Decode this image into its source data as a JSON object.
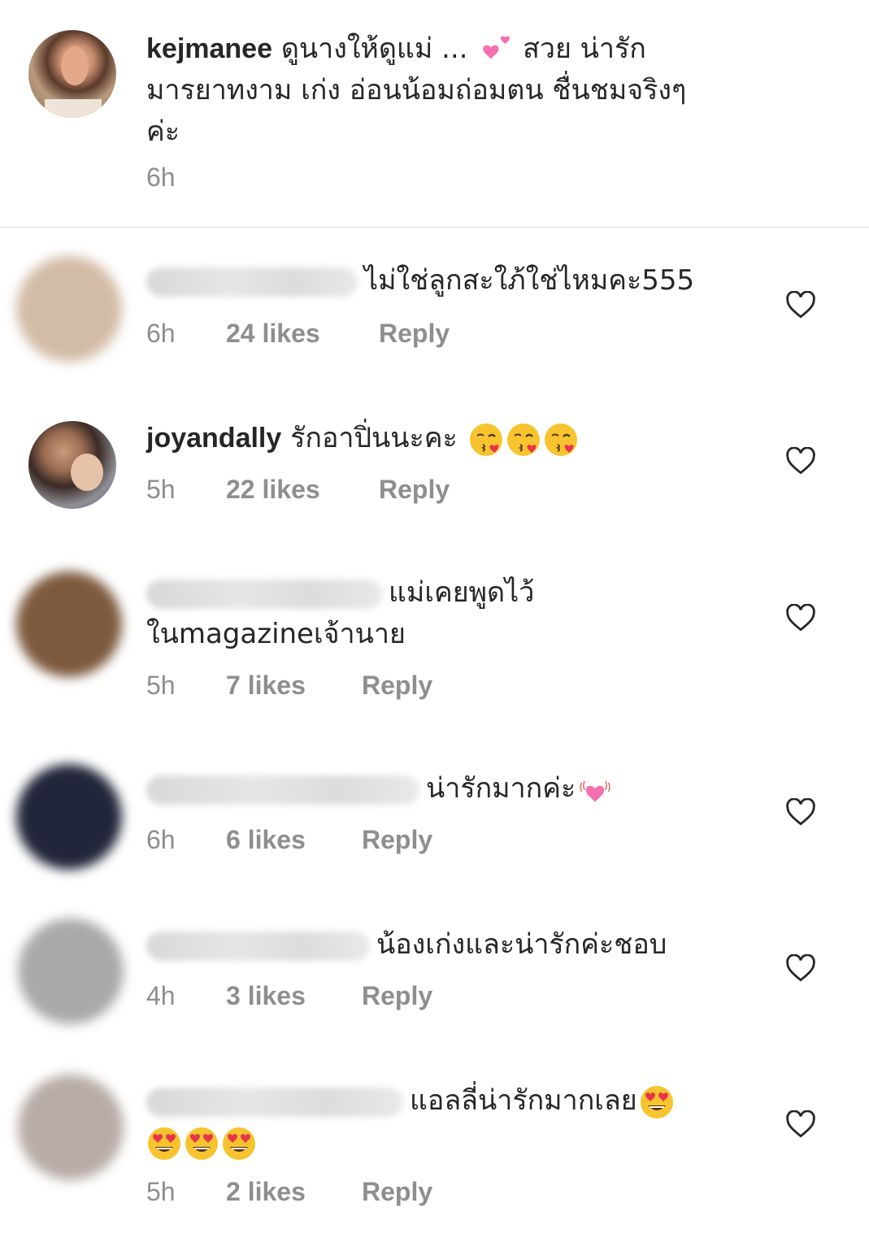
{
  "caption": {
    "username": "kejmanee",
    "text_line1": "ดูนางให้ดูแม่ ... ",
    "text_line1b": " สวย น่ารัก",
    "text_line2": "มารยาทงาม เก่ง อ่อนน้อมถ่อมตน ชื่นชมจริงๆ",
    "text_line3": "ค่ะ",
    "time": "6h",
    "emoji": "two-hearts-icon"
  },
  "comments": [
    {
      "username_blurred": true,
      "text": "ไม่ใช่ลูกสะใภ้ใช่ไหมคะ555",
      "time": "6h",
      "likes": "24 likes",
      "reply": "Reply"
    },
    {
      "username": "joyandally",
      "text": "รักอาปิ่นนะคะ ",
      "emoji": "kissing-face-icon x3",
      "time": "5h",
      "likes": "22 likes",
      "reply": "Reply"
    },
    {
      "username_blurred": true,
      "text_line1": "แม่เคยพูดไว้",
      "text_line2": "ในmagazineเจ้านาย",
      "time": "5h",
      "likes": "7 likes",
      "reply": "Reply"
    },
    {
      "username_blurred": true,
      "text": "น่ารักมากค่ะ",
      "emoji": "vibrating-heart-icon",
      "time": "6h",
      "likes": "6 likes",
      "reply": "Reply"
    },
    {
      "username_blurred": true,
      "text": "น้องเก่งและน่ารักค่ะชอบ",
      "time": "4h",
      "likes": "3 likes",
      "reply": "Reply"
    },
    {
      "username_blurred": true,
      "text": "แอลลี่น่ารักมากเลย",
      "emoji": "heart-eyes-face-icon x4",
      "time": "5h",
      "likes": "2 likes",
      "reply": "Reply"
    }
  ],
  "colors": {
    "muted": "#8e8e8e",
    "text": "#262626",
    "divider": "#dbdbdb"
  }
}
